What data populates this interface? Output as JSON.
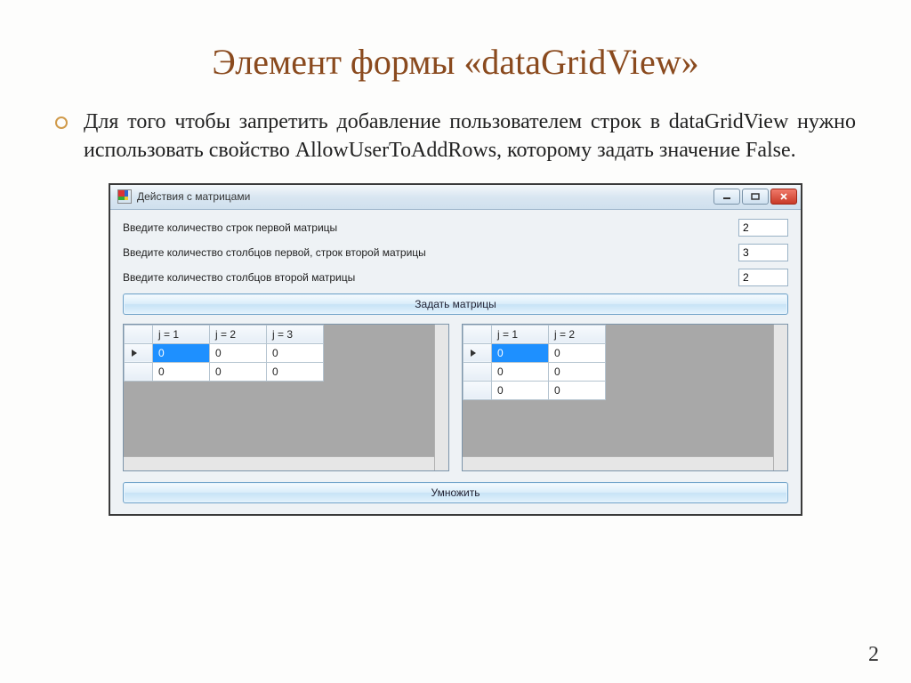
{
  "title": "Элемент формы «dataGridView»",
  "bullet": "Для того чтобы запретить добавление пользователем строк в dataGridView нужно использовать свойство AllowUserToAddRows, которому задать значение False.",
  "slide_number": "2",
  "window": {
    "title": "Действия с матрицами",
    "rows_label_1": "Введите количество строк первой матрицы",
    "rows_label_2": "Введите количество столбцов первой, строк второй матрицы",
    "rows_label_3": "Введите количество столбцов второй матрицы",
    "val1": "2",
    "val2": "3",
    "val3": "2",
    "btn_set": "Задать матрицы",
    "btn_mul": "Умножить"
  },
  "grid1": {
    "headers": [
      "j = 1",
      "j = 2",
      "j = 3"
    ],
    "rows": [
      [
        "0",
        "0",
        "0"
      ],
      [
        "0",
        "0",
        "0"
      ]
    ]
  },
  "grid2": {
    "headers": [
      "j = 1",
      "j = 2"
    ],
    "rows": [
      [
        "0",
        "0"
      ],
      [
        "0",
        "0"
      ],
      [
        "0",
        "0"
      ]
    ]
  }
}
